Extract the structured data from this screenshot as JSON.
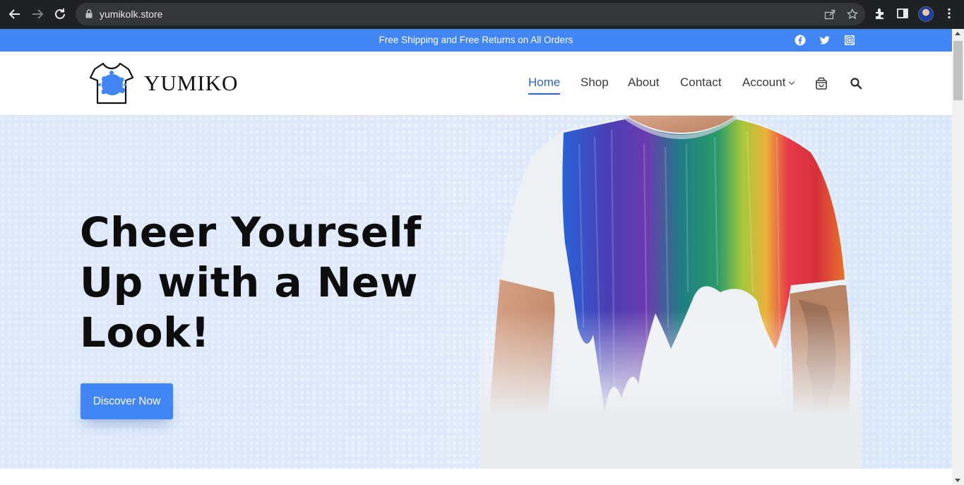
{
  "browser": {
    "url": "yumikolk.store",
    "icons": [
      "back-arrow-icon",
      "forward-arrow-icon",
      "reload-icon",
      "lock-icon",
      "share-icon",
      "star-icon",
      "extensions-icon",
      "side-panel-icon",
      "profile-avatar",
      "kebab-menu-icon"
    ]
  },
  "topbar": {
    "promo": "Free Shipping and Free Returns on All Orders",
    "social": [
      "facebook-icon",
      "twitter-icon",
      "instagram-icon"
    ],
    "color": "#4285f4"
  },
  "header": {
    "logo_text": "YUMIKO",
    "menu": [
      {
        "label": "Home",
        "active": true
      },
      {
        "label": "Shop",
        "active": false
      },
      {
        "label": "About",
        "active": false
      },
      {
        "label": "Contact",
        "active": false
      },
      {
        "label": "Account",
        "active": false,
        "has_dropdown": true
      }
    ],
    "icons": [
      "shopping-bag-icon",
      "search-icon"
    ],
    "active_color": "#2f63c9"
  },
  "hero": {
    "title": "Cheer Yourself Up with a New Look!",
    "cta_label": "Discover Now",
    "cta_color": "#4285f4"
  }
}
